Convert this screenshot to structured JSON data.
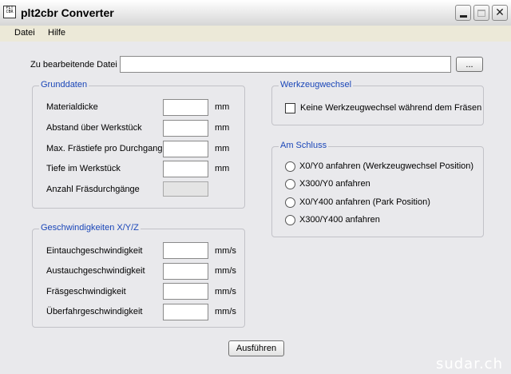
{
  "window": {
    "title": "plt2cbr Converter",
    "icon_text": "PLT",
    "icon_text2": "CBR"
  },
  "menu": {
    "items": [
      "Datei",
      "Hilfe"
    ]
  },
  "file": {
    "label": "Zu bearbeitende Datei",
    "value": "",
    "browse_label": "..."
  },
  "grunddaten": {
    "title": "Grunddaten",
    "fields": [
      {
        "label": "Materialdicke",
        "value": "",
        "unit": "mm"
      },
      {
        "label": "Abstand über Werkstück",
        "value": "",
        "unit": "mm"
      },
      {
        "label": "Max. Frästiefe pro Durchgang",
        "value": "",
        "unit": "mm"
      },
      {
        "label": "Tiefe im Werkstück",
        "value": "",
        "unit": "mm"
      },
      {
        "label": "Anzahl Fräsdurchgänge",
        "value": "",
        "unit": ""
      }
    ]
  },
  "geschwindigkeiten": {
    "title": "Geschwindigkeiten X/Y/Z",
    "fields": [
      {
        "label": "Eintauchgeschwindigkeit",
        "value": "",
        "unit": "mm/s"
      },
      {
        "label": "Austauchgeschwindigkeit",
        "value": "",
        "unit": "mm/s"
      },
      {
        "label": "Fräsgeschwindigkeit",
        "value": "",
        "unit": "mm/s"
      },
      {
        "label": "Überfahrgeschwindigkeit",
        "value": "",
        "unit": "mm/s"
      }
    ]
  },
  "werkzeugwechsel": {
    "title": "Werkzeugwechsel",
    "checkbox_label": "Keine Werkzeugwechsel während dem Fräsen",
    "checked": false
  },
  "am_schluss": {
    "title": "Am Schluss",
    "options": [
      "X0/Y0 anfahren (Werkzeugwechsel Position)",
      "X300/Y0 anfahren",
      "X0/Y400 anfahren (Park Position)",
      "X300/Y400 anfahren"
    ]
  },
  "run_button": "Ausführen",
  "watermark": "sudar.ch",
  "colors": {
    "legend_text": "#1a46b8",
    "panel_bg": "#e9e9ec"
  }
}
